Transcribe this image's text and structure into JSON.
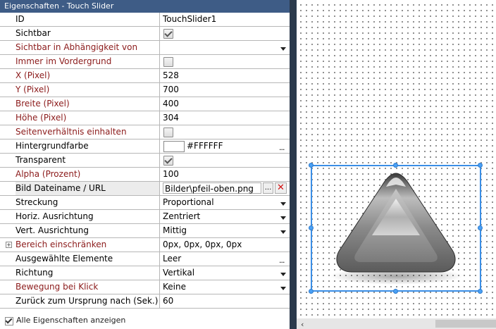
{
  "panel": {
    "title": "Eigenschaften - Touch Slider",
    "rows": [
      {
        "label": "ID",
        "value": "TouchSlider1"
      },
      {
        "label": "Sichtbar",
        "value": ""
      },
      {
        "label": "Sichtbar in Abhängigkeit von",
        "value": ""
      },
      {
        "label": "Immer im Vordergrund",
        "value": ""
      },
      {
        "label": "X (Pixel)",
        "value": "528"
      },
      {
        "label": "Y (Pixel)",
        "value": "700"
      },
      {
        "label": "Breite (Pixel)",
        "value": "400"
      },
      {
        "label": "Höhe (Pixel)",
        "value": "304"
      },
      {
        "label": "Seitenverhältnis einhalten",
        "value": ""
      },
      {
        "label": "Hintergrundfarbe",
        "value": "#FFFFFF"
      },
      {
        "label": "Transparent",
        "value": ""
      },
      {
        "label": "Alpha (Prozent)",
        "value": "100"
      },
      {
        "label": "Bild Dateiname / URL",
        "value": "Bilder\\pfeil-oben.png"
      },
      {
        "label": "Streckung",
        "value": "Proportional"
      },
      {
        "label": "Horiz. Ausrichtung",
        "value": "Zentriert"
      },
      {
        "label": "Vert. Ausrichtung",
        "value": "Mittig"
      },
      {
        "label": "Bereich einschränken",
        "value": "0px, 0px, 0px, 0px"
      },
      {
        "label": "Ausgewählte Elemente",
        "value": "Leer"
      },
      {
        "label": "Richtung",
        "value": "Vertikal"
      },
      {
        "label": "Bewegung bei Klick",
        "value": "Keine"
      },
      {
        "label": "Zurück zum Ursprung nach (Sek.)",
        "value": "60"
      }
    ],
    "states": {
      "sichtbar_checked": true,
      "immer_checked": false,
      "seitenverhaeltnis_checked": false,
      "transparent_checked": true
    },
    "ellipsis": "...",
    "clear_symbol": "✕",
    "expand_symbol": "+",
    "footer_label": "Alle Eigenschaften anzeigen"
  },
  "scroll_left_arrow": "‹",
  "colors": {
    "title_bar": "#3e5c86",
    "red_label": "#8b1a1a",
    "selection": "#3a8ee6",
    "divider": "#2b3a4c"
  },
  "canvas": {
    "selected_object": "arrow-up-image"
  }
}
